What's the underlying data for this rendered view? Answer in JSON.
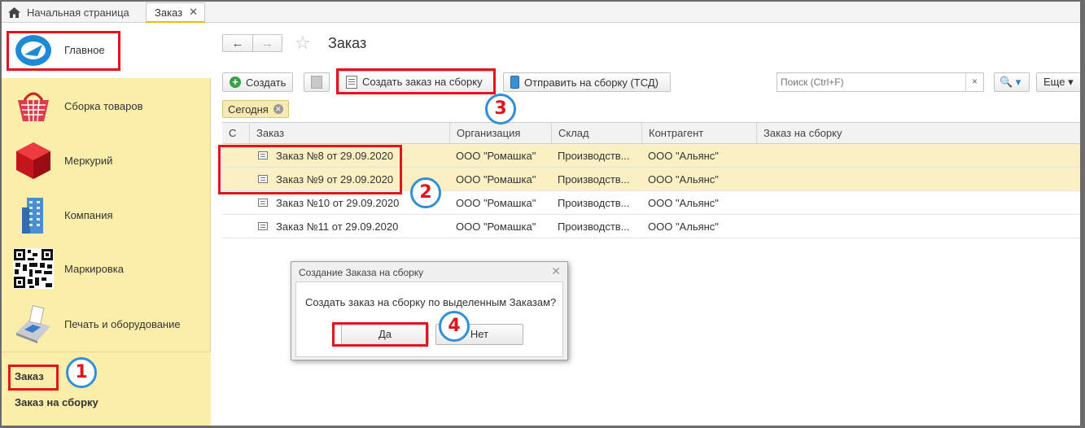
{
  "tabs": {
    "home_label": "Начальная страница",
    "doc_label": "Заказ",
    "doc_close": "✕"
  },
  "sidebar": {
    "main_label": "Главное",
    "items": [
      {
        "label": "Сборка товаров",
        "icon": "basket-icon"
      },
      {
        "label": "Меркурий",
        "icon": "red-cube-icon"
      },
      {
        "label": "Компания",
        "icon": "building-icon"
      },
      {
        "label": "Маркировка",
        "icon": "qr-code-icon"
      },
      {
        "label": "Печать и оборудование",
        "icon": "pos-terminal-icon"
      }
    ],
    "links": [
      "Заказ",
      "Заказ на сборку"
    ]
  },
  "header": {
    "back": "←",
    "forward": "→",
    "star": "☆",
    "title": "Заказ"
  },
  "toolbar": {
    "create_label": "Создать",
    "create_order_label": "Создать заказ на сборку",
    "send_label": "Отправить на сборку (ТСД)",
    "search_placeholder": "Поиск (Ctrl+F)",
    "search_clear": "×",
    "search_btn": "🔍 ▾",
    "more_label": "Еще ▾"
  },
  "filter_chip": "Сегодня",
  "table": {
    "columns": [
      "С",
      "Заказ",
      "Организация",
      "Склад",
      "Контрагент",
      "Заказ на сборку"
    ],
    "rows": [
      {
        "order": "Заказ №8 от 29.09.2020",
        "org": "ООО \"Ромашка\"",
        "warehouse": "Производств...",
        "counterparty": "ООО \"Альянс\"",
        "assembly": "",
        "selected": true
      },
      {
        "order": "Заказ №9 от 29.09.2020",
        "org": "ООО \"Ромашка\"",
        "warehouse": "Производств...",
        "counterparty": "ООО \"Альянс\"",
        "assembly": "",
        "selected": true
      },
      {
        "order": "Заказ №10 от 29.09.2020",
        "org": "ООО \"Ромашка\"",
        "warehouse": "Производств...",
        "counterparty": "ООО \"Альянс\"",
        "assembly": "",
        "selected": false
      },
      {
        "order": "Заказ №11 от 29.09.2020",
        "org": "ООО \"Ромашка\"",
        "warehouse": "Производств...",
        "counterparty": "ООО \"Альянс\"",
        "assembly": "",
        "selected": false
      }
    ]
  },
  "dialog": {
    "title": "Создание Заказа на сборку",
    "close": "✕",
    "message": "Создать заказ на сборку по выделенным Заказам?",
    "yes": "Да",
    "no": "Нет"
  },
  "annotations": {
    "badges": [
      "1",
      "2",
      "3",
      "4"
    ],
    "color_box": "#e3141a",
    "color_circle": "#2f8fd8"
  }
}
